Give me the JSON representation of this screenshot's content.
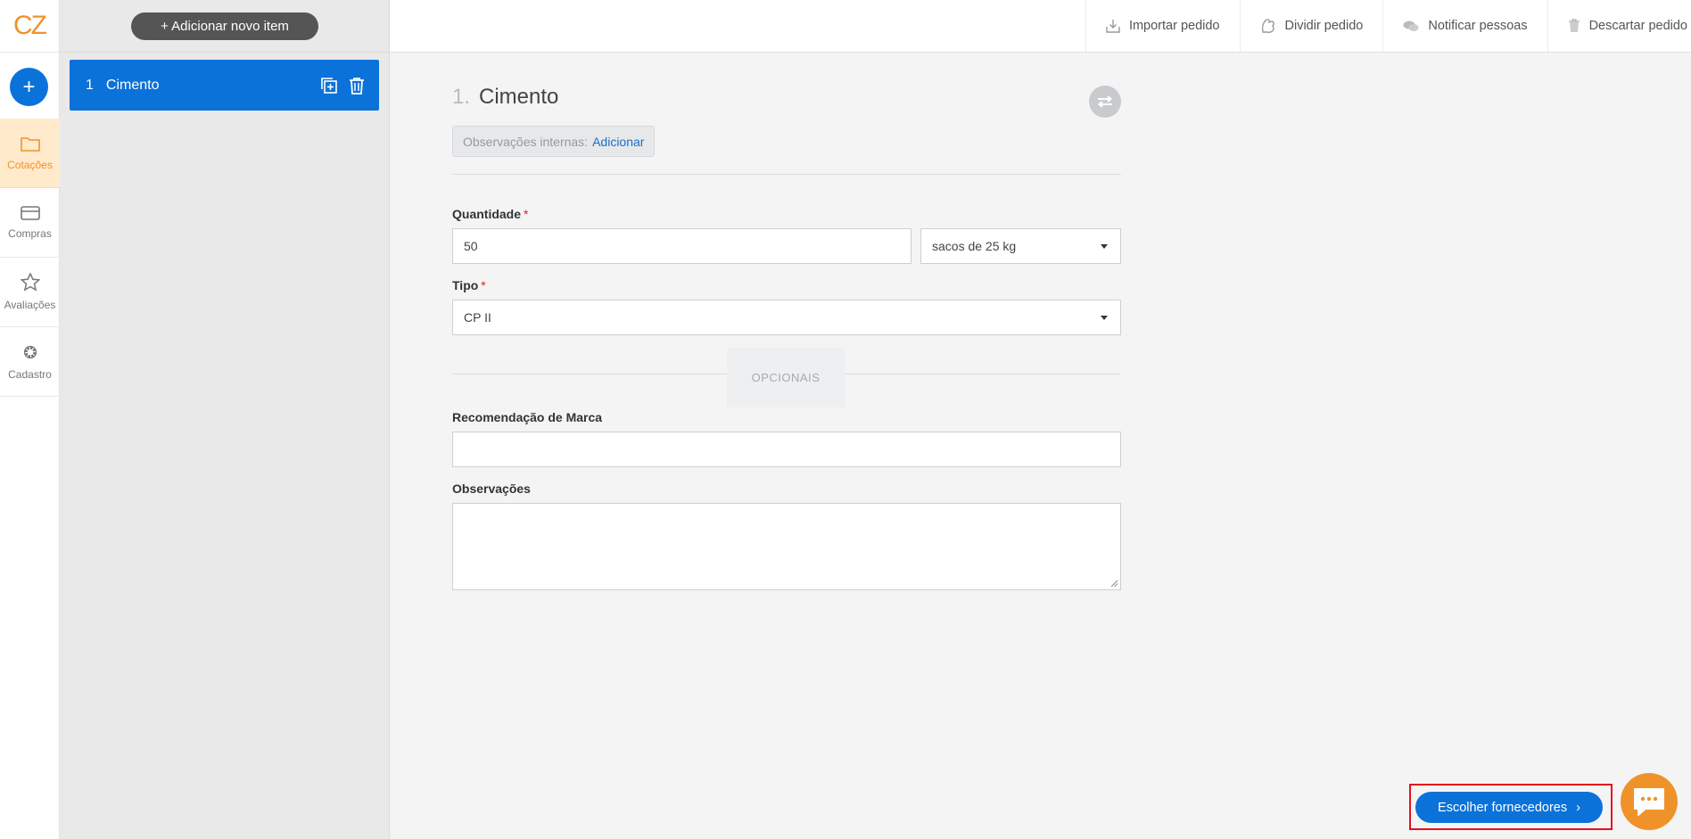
{
  "logo": {
    "text": "CZ"
  },
  "nav": {
    "add_label": "+",
    "items": [
      {
        "label": "Cotações",
        "icon": "folder-icon",
        "active": true
      },
      {
        "label": "Compras",
        "icon": "card-icon"
      },
      {
        "label": "Avaliações",
        "icon": "star-icon"
      },
      {
        "label": "Cadastro",
        "icon": "gear-icon"
      }
    ]
  },
  "item_list": {
    "add_button": "+ Adicionar novo item",
    "items": [
      {
        "number": "1",
        "name": "Cimento"
      }
    ]
  },
  "toolbar": {
    "import": "Importar pedido",
    "split": "Dividir pedido",
    "notify": "Notificar pessoas",
    "discard": "Descartar pedido"
  },
  "form": {
    "index": "1.",
    "title": "Cimento",
    "internal_notes_label": "Observações internas:",
    "internal_notes_link": "Adicionar",
    "quantity_label": "Quantidade",
    "required_mark": "*",
    "quantity_value": "50",
    "unit_value": "sacos de 25 kg",
    "type_label": "Tipo",
    "type_value": "CP II",
    "optional_divider": "OPCIONAIS",
    "brand_label": "Recomendação de Marca",
    "brand_value": "",
    "notes_label": "Observações",
    "notes_value": ""
  },
  "footer": {
    "choose_suppliers": "Escolher fornecedores",
    "choose_arrow": "›"
  },
  "colors": {
    "primary": "#0b72d9",
    "accent": "#f0922a",
    "highlight": "#e3101e"
  }
}
